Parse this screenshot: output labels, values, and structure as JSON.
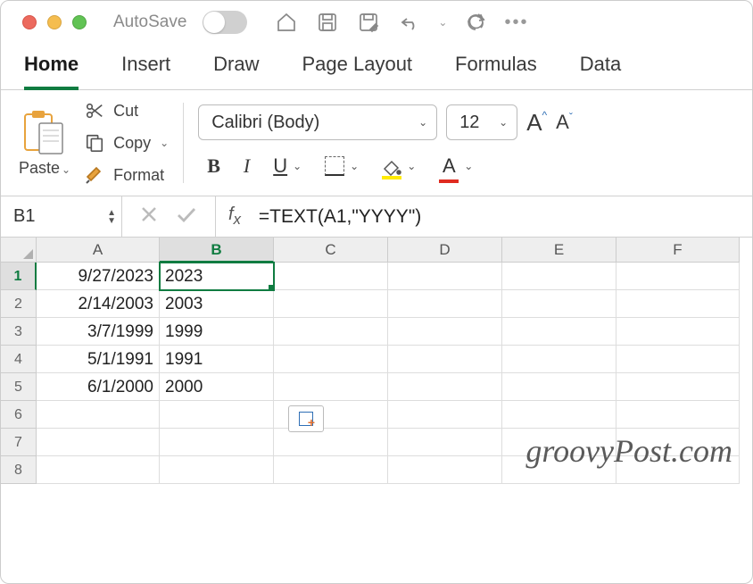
{
  "titlebar": {
    "autosave_label": "AutoSave"
  },
  "tabs": [
    "Home",
    "Insert",
    "Draw",
    "Page Layout",
    "Formulas",
    "Data"
  ],
  "active_tab": 0,
  "clipboard": {
    "paste": "Paste",
    "cut": "Cut",
    "copy": "Copy",
    "format": "Format"
  },
  "font": {
    "name": "Calibri (Body)",
    "size": "12"
  },
  "namebox": "B1",
  "formula": "=TEXT(A1,\"YYYY\")",
  "columns": [
    "A",
    "B",
    "C",
    "D",
    "E",
    "F"
  ],
  "selected_col": 1,
  "selected_row": 0,
  "rows": [
    {
      "num": "1",
      "A": "9/27/2023",
      "B": "2023"
    },
    {
      "num": "2",
      "A": "2/14/2003",
      "B": "2003"
    },
    {
      "num": "3",
      "A": "3/7/1999",
      "B": "1999"
    },
    {
      "num": "4",
      "A": "5/1/1991",
      "B": "1991"
    },
    {
      "num": "5",
      "A": "6/1/2000",
      "B": "2000"
    },
    {
      "num": "6",
      "A": "",
      "B": ""
    },
    {
      "num": "7",
      "A": "",
      "B": ""
    },
    {
      "num": "8",
      "A": "",
      "B": ""
    }
  ],
  "watermark": "groovyPost.com"
}
